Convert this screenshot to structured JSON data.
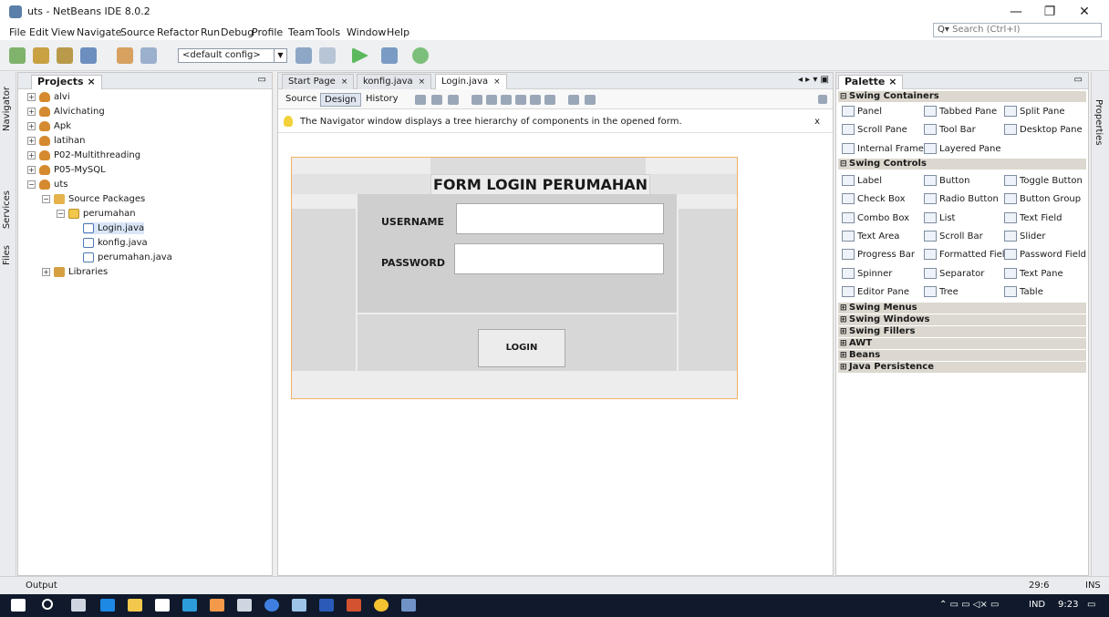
{
  "window": {
    "title": "uts - NetBeans IDE 8.0.2",
    "minimize": "—",
    "maximize": "❐",
    "close": "✕"
  },
  "menu": [
    "File",
    "Edit",
    "View",
    "Navigate",
    "Source",
    "Refactor",
    "Run",
    "Debug",
    "Profile",
    "Team",
    "Tools",
    "Window",
    "Help"
  ],
  "search": {
    "placeholder": "Search (Ctrl+I)"
  },
  "toolbar": {
    "config": "<default config>"
  },
  "side_tabs": {
    "navigator": "Navigator",
    "services": "Services",
    "files": "Files",
    "properties": "Properties"
  },
  "projects": {
    "title": "Projects",
    "close": "×",
    "nodes": [
      "alvi",
      "Alvichating",
      "Apk",
      "latihan",
      "P02-Multithreading",
      "P05-MySQL",
      "uts",
      "Source Packages",
      "perumahan",
      "Login.java",
      "konfig.java",
      "perumahan.java",
      "Libraries"
    ]
  },
  "editor": {
    "tabs": [
      "Start Page",
      "konfig.java",
      "Login.java"
    ],
    "views": [
      "Source",
      "Design",
      "History"
    ],
    "hint": "The Navigator window displays a tree hierarchy of components in the opened form.",
    "hint_close": "x"
  },
  "form": {
    "title": "FORM LOGIN PERUMAHAN",
    "username_label": "USERNAME",
    "password_label": "PASSWORD",
    "login_label": "LOGIN"
  },
  "palette": {
    "title": "Palette",
    "categories": {
      "swing_containers": "Swing Containers",
      "swing_controls": "Swing Controls",
      "swing_menus": "Swing Menus",
      "swing_windows": "Swing Windows",
      "swing_fillers": "Swing Fillers",
      "awt": "AWT",
      "beans": "Beans",
      "java_persistence": "Java Persistence"
    },
    "containers": [
      "Panel",
      "Tabbed Pane",
      "Split Pane",
      "Scroll Pane",
      "Tool Bar",
      "Desktop Pane",
      "Internal Frame",
      "Layered Pane"
    ],
    "controls": [
      "Label",
      "Button",
      "Toggle Button",
      "Check Box",
      "Radio Button",
      "Button Group",
      "Combo Box",
      "List",
      "Text Field",
      "Text Area",
      "Scroll Bar",
      "Slider",
      "Progress Bar",
      "Formatted Field",
      "Password Field",
      "Spinner",
      "Separator",
      "Text Pane",
      "Editor Pane",
      "Tree",
      "Table"
    ]
  },
  "status": {
    "output": "Output",
    "position": "29:6",
    "mode": "INS"
  },
  "taskbar": {
    "lang": "IND",
    "time": "9:23"
  }
}
